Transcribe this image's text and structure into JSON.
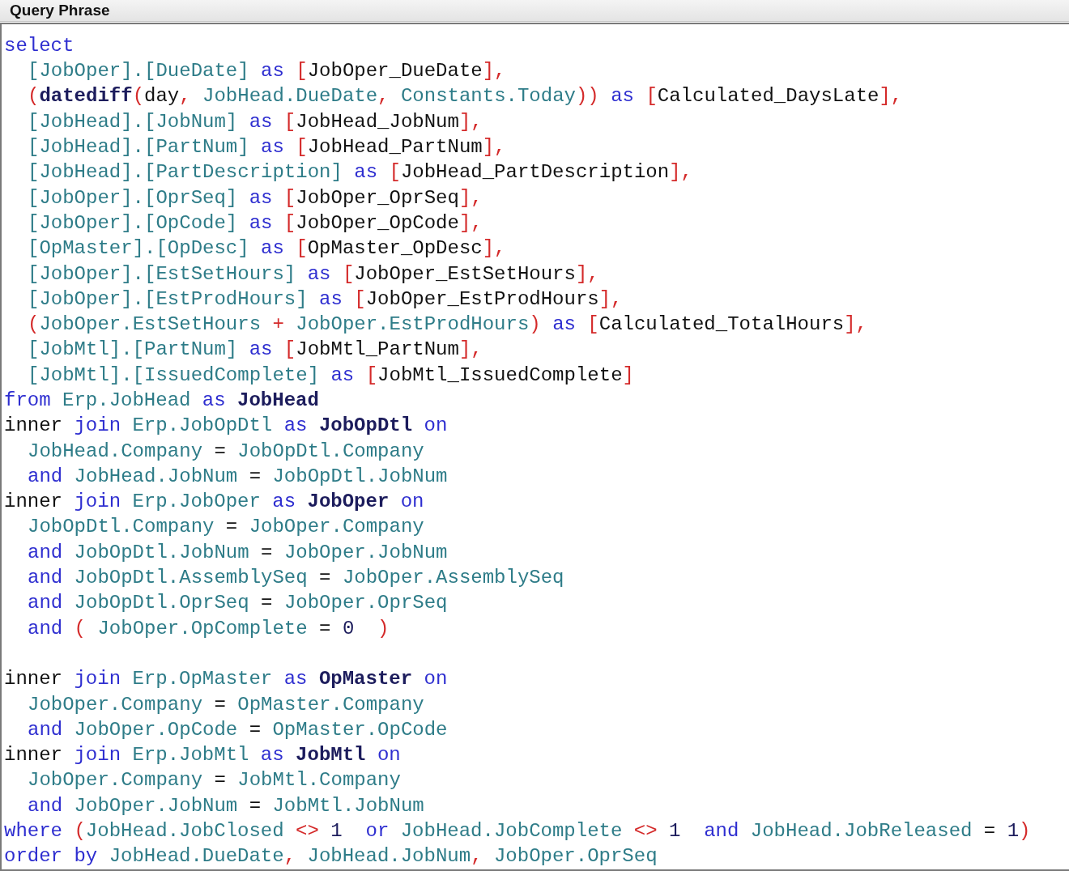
{
  "panel": {
    "title": "Query Phrase"
  },
  "editor": {
    "lines": [
      {
        "kind": "code",
        "tokens": [
          {
            "kind": "kw",
            "text": "select"
          }
        ],
        "children": [
          {
            "kind": "code",
            "tokens": [
              {
                "kind": "id",
                "text": "[JobOper].[DueDate]"
              },
              {
                "kind": "kw",
                "text": " as "
              },
              {
                "kind": "red",
                "text": "["
              },
              {
                "kind": "plain",
                "text": "JobOper_DueDate"
              },
              {
                "kind": "red",
                "text": "],"
              }
            ]
          },
          {
            "kind": "code",
            "tokens": [
              {
                "kind": "red",
                "text": "("
              },
              {
                "kind": "bold",
                "text": "datediff"
              },
              {
                "kind": "red",
                "text": "("
              },
              {
                "kind": "plain",
                "text": "day"
              },
              {
                "kind": "red",
                "text": ", "
              },
              {
                "kind": "id",
                "text": "JobHead.DueDate"
              },
              {
                "kind": "red",
                "text": ", "
              },
              {
                "kind": "id",
                "text": "Constants.Today"
              },
              {
                "kind": "red",
                "text": "))"
              },
              {
                "kind": "kw",
                "text": " as "
              },
              {
                "kind": "red",
                "text": "["
              },
              {
                "kind": "plain",
                "text": "Calculated_DaysLate"
              },
              {
                "kind": "red",
                "text": "],"
              }
            ]
          },
          {
            "kind": "code",
            "tokens": [
              {
                "kind": "id",
                "text": "[JobHead].[JobNum]"
              },
              {
                "kind": "kw",
                "text": " as "
              },
              {
                "kind": "red",
                "text": "["
              },
              {
                "kind": "plain",
                "text": "JobHead_JobNum"
              },
              {
                "kind": "red",
                "text": "],"
              }
            ]
          },
          {
            "kind": "code",
            "tokens": [
              {
                "kind": "id",
                "text": "[JobHead].[PartNum]"
              },
              {
                "kind": "kw",
                "text": " as "
              },
              {
                "kind": "red",
                "text": "["
              },
              {
                "kind": "plain",
                "text": "JobHead_PartNum"
              },
              {
                "kind": "red",
                "text": "],"
              }
            ]
          },
          {
            "kind": "code",
            "tokens": [
              {
                "kind": "id",
                "text": "[JobHead].[PartDescription]"
              },
              {
                "kind": "kw",
                "text": " as "
              },
              {
                "kind": "red",
                "text": "["
              },
              {
                "kind": "plain",
                "text": "JobHead_PartDescription"
              },
              {
                "kind": "red",
                "text": "],"
              }
            ]
          },
          {
            "kind": "code",
            "tokens": [
              {
                "kind": "id",
                "text": "[JobOper].[OprSeq]"
              },
              {
                "kind": "kw",
                "text": " as "
              },
              {
                "kind": "red",
                "text": "["
              },
              {
                "kind": "plain",
                "text": "JobOper_OprSeq"
              },
              {
                "kind": "red",
                "text": "],"
              }
            ]
          },
          {
            "kind": "code",
            "tokens": [
              {
                "kind": "id",
                "text": "[JobOper].[OpCode]"
              },
              {
                "kind": "kw",
                "text": " as "
              },
              {
                "kind": "red",
                "text": "["
              },
              {
                "kind": "plain",
                "text": "JobOper_OpCode"
              },
              {
                "kind": "red",
                "text": "],"
              }
            ]
          },
          {
            "kind": "code",
            "tokens": [
              {
                "kind": "id",
                "text": "[OpMaster].[OpDesc]"
              },
              {
                "kind": "kw",
                "text": " as "
              },
              {
                "kind": "red",
                "text": "["
              },
              {
                "kind": "plain",
                "text": "OpMaster_OpDesc"
              },
              {
                "kind": "red",
                "text": "],"
              }
            ]
          },
          {
            "kind": "code",
            "tokens": [
              {
                "kind": "id",
                "text": "[JobOper].[EstSetHours]"
              },
              {
                "kind": "kw",
                "text": " as "
              },
              {
                "kind": "red",
                "text": "["
              },
              {
                "kind": "plain",
                "text": "JobOper_EstSetHours"
              },
              {
                "kind": "red",
                "text": "],"
              }
            ]
          },
          {
            "kind": "code",
            "tokens": [
              {
                "kind": "id",
                "text": "[JobOper].[EstProdHours]"
              },
              {
                "kind": "kw",
                "text": " as "
              },
              {
                "kind": "red",
                "text": "["
              },
              {
                "kind": "plain",
                "text": "JobOper_EstProdHours"
              },
              {
                "kind": "red",
                "text": "],"
              }
            ]
          },
          {
            "kind": "code",
            "tokens": [
              {
                "kind": "red",
                "text": "("
              },
              {
                "kind": "id",
                "text": "JobOper.EstSetHours"
              },
              {
                "kind": "red",
                "text": " + "
              },
              {
                "kind": "id",
                "text": "JobOper.EstProdHours"
              },
              {
                "kind": "red",
                "text": ")"
              },
              {
                "kind": "kw",
                "text": " as "
              },
              {
                "kind": "red",
                "text": "["
              },
              {
                "kind": "plain",
                "text": "Calculated_TotalHours"
              },
              {
                "kind": "red",
                "text": "],"
              }
            ]
          },
          {
            "kind": "code",
            "tokens": [
              {
                "kind": "id",
                "text": "[JobMtl].[PartNum]"
              },
              {
                "kind": "kw",
                "text": " as "
              },
              {
                "kind": "red",
                "text": "["
              },
              {
                "kind": "plain",
                "text": "JobMtl_PartNum"
              },
              {
                "kind": "red",
                "text": "],"
              }
            ]
          },
          {
            "kind": "code",
            "tokens": [
              {
                "kind": "id",
                "text": "[JobMtl].[IssuedComplete]"
              },
              {
                "kind": "kw",
                "text": " as "
              },
              {
                "kind": "red",
                "text": "["
              },
              {
                "kind": "plain",
                "text": "JobMtl_IssuedComplete"
              },
              {
                "kind": "red",
                "text": "]"
              }
            ]
          }
        ]
      },
      {
        "kind": "code",
        "tokens": [
          {
            "kind": "kw",
            "text": "from "
          },
          {
            "kind": "id",
            "text": "Erp.JobHead"
          },
          {
            "kind": "kw",
            "text": " as "
          },
          {
            "kind": "bold",
            "text": "JobHead"
          }
        ]
      },
      {
        "kind": "code",
        "tokens": [
          {
            "kind": "plain",
            "text": "inner "
          },
          {
            "kind": "kw",
            "text": "join "
          },
          {
            "kind": "id",
            "text": "Erp.JobOpDtl"
          },
          {
            "kind": "kw",
            "text": " as "
          },
          {
            "kind": "bold",
            "text": "JobOpDtl"
          },
          {
            "kind": "kw",
            "text": " on"
          }
        ],
        "children": [
          {
            "kind": "code",
            "tokens": [
              {
                "kind": "id",
                "text": "JobHead.Company"
              },
              {
                "kind": "plain",
                "text": " = "
              },
              {
                "kind": "id",
                "text": "JobOpDtl.Company"
              }
            ]
          },
          {
            "kind": "code",
            "tokens": [
              {
                "kind": "kw",
                "text": "and "
              },
              {
                "kind": "id",
                "text": "JobHead.JobNum"
              },
              {
                "kind": "plain",
                "text": " = "
              },
              {
                "kind": "id",
                "text": "JobOpDtl.JobNum"
              }
            ]
          }
        ]
      },
      {
        "kind": "code",
        "tokens": [
          {
            "kind": "plain",
            "text": "inner "
          },
          {
            "kind": "kw",
            "text": "join "
          },
          {
            "kind": "id",
            "text": "Erp.JobOper"
          },
          {
            "kind": "kw",
            "text": " as "
          },
          {
            "kind": "bold",
            "text": "JobOper"
          },
          {
            "kind": "kw",
            "text": " on"
          }
        ],
        "children": [
          {
            "kind": "code",
            "tokens": [
              {
                "kind": "id",
                "text": "JobOpDtl.Company"
              },
              {
                "kind": "plain",
                "text": " = "
              },
              {
                "kind": "id",
                "text": "JobOper.Company"
              }
            ]
          },
          {
            "kind": "code",
            "tokens": [
              {
                "kind": "kw",
                "text": "and "
              },
              {
                "kind": "id",
                "text": "JobOpDtl.JobNum"
              },
              {
                "kind": "plain",
                "text": " = "
              },
              {
                "kind": "id",
                "text": "JobOper.JobNum"
              }
            ]
          },
          {
            "kind": "code",
            "tokens": [
              {
                "kind": "kw",
                "text": "and "
              },
              {
                "kind": "id",
                "text": "JobOpDtl.AssemblySeq"
              },
              {
                "kind": "plain",
                "text": " = "
              },
              {
                "kind": "id",
                "text": "JobOper.AssemblySeq"
              }
            ]
          },
          {
            "kind": "code",
            "tokens": [
              {
                "kind": "kw",
                "text": "and "
              },
              {
                "kind": "id",
                "text": "JobOpDtl.OprSeq"
              },
              {
                "kind": "plain",
                "text": " = "
              },
              {
                "kind": "id",
                "text": "JobOper.OprSeq"
              }
            ]
          },
          {
            "kind": "code",
            "tokens": [
              {
                "kind": "kw",
                "text": "and "
              },
              {
                "kind": "red",
                "text": "( "
              },
              {
                "kind": "id",
                "text": "JobOper.OpComplete"
              },
              {
                "kind": "plain",
                "text": " = "
              },
              {
                "kind": "num",
                "text": "0"
              },
              {
                "kind": "red",
                "text": "  )"
              }
            ]
          }
        ]
      },
      {
        "kind": "blank"
      },
      {
        "kind": "code",
        "tokens": [
          {
            "kind": "plain",
            "text": "inner "
          },
          {
            "kind": "kw",
            "text": "join "
          },
          {
            "kind": "id",
            "text": "Erp.OpMaster"
          },
          {
            "kind": "kw",
            "text": " as "
          },
          {
            "kind": "bold",
            "text": "OpMaster"
          },
          {
            "kind": "kw",
            "text": " on"
          }
        ],
        "children": [
          {
            "kind": "code",
            "tokens": [
              {
                "kind": "id",
                "text": "JobOper.Company"
              },
              {
                "kind": "plain",
                "text": " = "
              },
              {
                "kind": "id",
                "text": "OpMaster.Company"
              }
            ]
          },
          {
            "kind": "code",
            "tokens": [
              {
                "kind": "kw",
                "text": "and "
              },
              {
                "kind": "id",
                "text": "JobOper.OpCode"
              },
              {
                "kind": "plain",
                "text": " = "
              },
              {
                "kind": "id",
                "text": "OpMaster.OpCode"
              }
            ]
          }
        ]
      },
      {
        "kind": "code",
        "tokens": [
          {
            "kind": "plain",
            "text": "inner "
          },
          {
            "kind": "kw",
            "text": "join "
          },
          {
            "kind": "id",
            "text": "Erp.JobMtl"
          },
          {
            "kind": "kw",
            "text": " as "
          },
          {
            "kind": "bold",
            "text": "JobMtl"
          },
          {
            "kind": "kw",
            "text": " on"
          }
        ],
        "children": [
          {
            "kind": "code",
            "tokens": [
              {
                "kind": "id",
                "text": "JobOper.Company"
              },
              {
                "kind": "plain",
                "text": " = "
              },
              {
                "kind": "id",
                "text": "JobMtl.Company"
              }
            ]
          },
          {
            "kind": "code",
            "tokens": [
              {
                "kind": "kw",
                "text": "and "
              },
              {
                "kind": "id",
                "text": "JobOper.JobNum"
              },
              {
                "kind": "plain",
                "text": " = "
              },
              {
                "kind": "id",
                "text": "JobMtl.JobNum"
              }
            ]
          }
        ]
      },
      {
        "kind": "code",
        "tokens": [
          {
            "kind": "kw",
            "text": "where "
          },
          {
            "kind": "red",
            "text": "("
          },
          {
            "kind": "id",
            "text": "JobHead.JobClosed"
          },
          {
            "kind": "red",
            "text": " <> "
          },
          {
            "kind": "num",
            "text": "1"
          },
          {
            "kind": "kw",
            "text": "  or "
          },
          {
            "kind": "id",
            "text": "JobHead.JobComplete"
          },
          {
            "kind": "red",
            "text": " <> "
          },
          {
            "kind": "num",
            "text": "1"
          },
          {
            "kind": "kw",
            "text": "  and "
          },
          {
            "kind": "id",
            "text": "JobHead.JobReleased"
          },
          {
            "kind": "plain",
            "text": " = "
          },
          {
            "kind": "num",
            "text": "1"
          },
          {
            "kind": "red",
            "text": ")"
          }
        ]
      },
      {
        "kind": "code",
        "tokens": [
          {
            "kind": "kw",
            "text": "order by "
          },
          {
            "kind": "id",
            "text": "JobHead.DueDate"
          },
          {
            "kind": "red",
            "text": ", "
          },
          {
            "kind": "id",
            "text": "JobHead.JobNum"
          },
          {
            "kind": "red",
            "text": ", "
          },
          {
            "kind": "id",
            "text": "JobOper.OprSeq"
          }
        ]
      }
    ]
  }
}
